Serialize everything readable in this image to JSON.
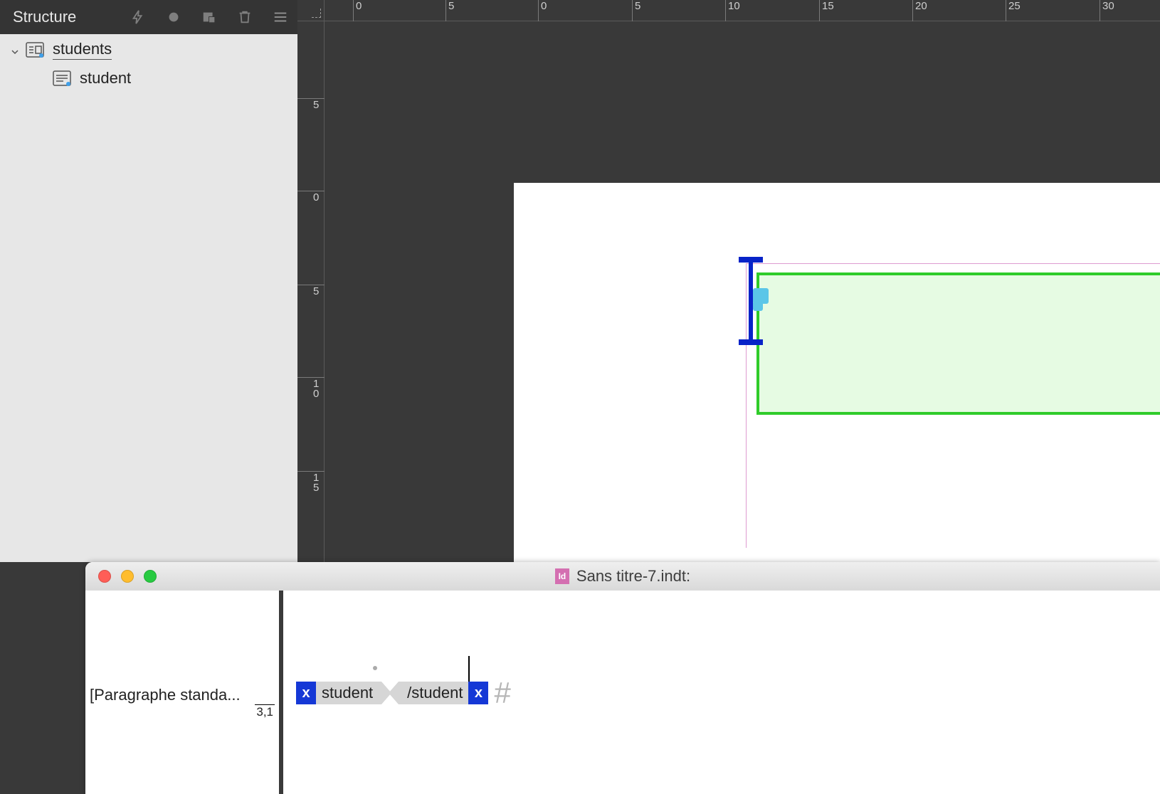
{
  "panel": {
    "title": "Structure",
    "tree": {
      "root": {
        "label": "students"
      },
      "child": {
        "label": "student"
      }
    }
  },
  "ruler": {
    "h": [
      "0",
      "5",
      "0",
      "5",
      "10",
      "15",
      "20",
      "25",
      "30"
    ],
    "v": [
      "5",
      "0",
      "5",
      "1\n0",
      "1\n5"
    ]
  },
  "story": {
    "filename": "Sans titre-7.indt:",
    "paragraph_style": "[Paragraphe standa...",
    "line_number": "3,1",
    "tag_open": "student",
    "tag_close": "/student",
    "end_marker": "#",
    "tag_x": "x"
  }
}
